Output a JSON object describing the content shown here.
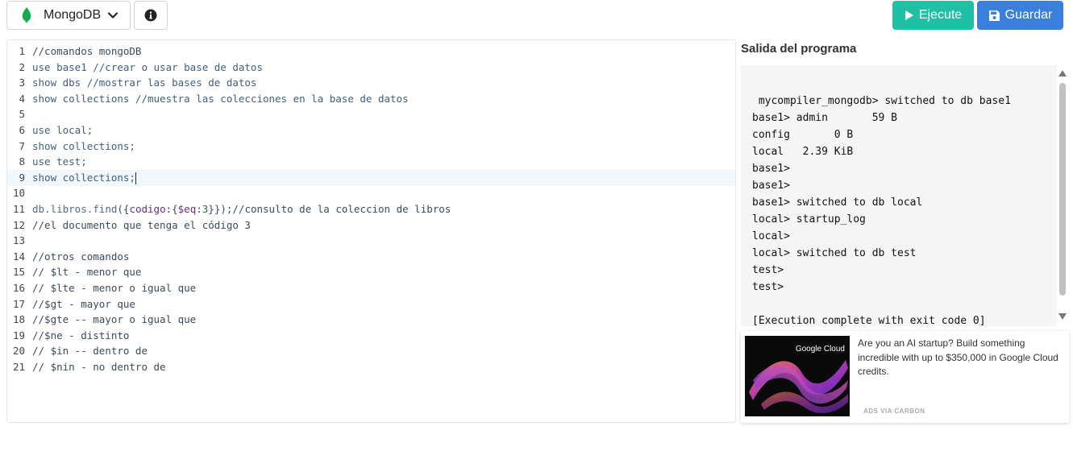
{
  "toolbar": {
    "language": "MongoDB",
    "run_label": "Ejecute",
    "save_label": "Guardar",
    "colors": {
      "run": "#20c0a4",
      "save": "#3a7fdc",
      "mongo_leaf": "#13aa52"
    }
  },
  "editor": {
    "active_line": 9,
    "lines": [
      {
        "n": "1",
        "tokens": [
          {
            "t": "//comandos mongoDB",
            "c": "cm"
          }
        ]
      },
      {
        "n": "2",
        "tokens": [
          {
            "t": "use base1 //crear o usar base de datos",
            "c": "kw"
          }
        ]
      },
      {
        "n": "3",
        "tokens": [
          {
            "t": "show dbs //mostrar las bases de datos",
            "c": "kw"
          }
        ]
      },
      {
        "n": "4",
        "tokens": [
          {
            "t": "show collections //muestra las colecciones en la base de datos",
            "c": "kw"
          }
        ]
      },
      {
        "n": "5",
        "tokens": []
      },
      {
        "n": "6",
        "tokens": [
          {
            "t": "use local;",
            "c": "kw"
          }
        ]
      },
      {
        "n": "7",
        "tokens": [
          {
            "t": "show collections;",
            "c": "kw"
          }
        ]
      },
      {
        "n": "8",
        "tokens": [
          {
            "t": "use test;",
            "c": "kw"
          }
        ]
      },
      {
        "n": "9",
        "tokens": [
          {
            "t": "show collections;",
            "c": "kw"
          }
        ]
      },
      {
        "n": "10",
        "tokens": []
      },
      {
        "n": "11",
        "tokens": [
          {
            "t": "db.",
            "c": "fn"
          },
          {
            "t": "libros",
            "c": "fn"
          },
          {
            "t": ".",
            "c": "fn"
          },
          {
            "t": "find",
            "c": "fn"
          },
          {
            "t": "({",
            "c": "cm"
          },
          {
            "t": "codigo",
            "c": "prop"
          },
          {
            "t": ":{",
            "c": "cm"
          },
          {
            "t": "$eq",
            "c": "prop"
          },
          {
            "t": ":",
            "c": "cm"
          },
          {
            "t": "3",
            "c": "num"
          },
          {
            "t": "}});//consulto de la coleccion de libros",
            "c": "cm"
          }
        ]
      },
      {
        "n": "12",
        "tokens": [
          {
            "t": "//el documento que tenga el código 3",
            "c": "cm"
          }
        ]
      },
      {
        "n": "13",
        "tokens": []
      },
      {
        "n": "14",
        "tokens": [
          {
            "t": "//otros comandos",
            "c": "cm"
          }
        ]
      },
      {
        "n": "15",
        "tokens": [
          {
            "t": "// $lt - menor que",
            "c": "cm"
          }
        ]
      },
      {
        "n": "16",
        "tokens": [
          {
            "t": "// $lte - menor o igual que",
            "c": "cm"
          }
        ]
      },
      {
        "n": "17",
        "tokens": [
          {
            "t": "//$gt - mayor que",
            "c": "cm"
          }
        ]
      },
      {
        "n": "18",
        "tokens": [
          {
            "t": "//$gte -- mayor o igual que",
            "c": "cm"
          }
        ]
      },
      {
        "n": "19",
        "tokens": [
          {
            "t": "//$ne - distinto",
            "c": "cm"
          }
        ]
      },
      {
        "n": "20",
        "tokens": [
          {
            "t": "// $in -- dentro de",
            "c": "cm"
          }
        ]
      },
      {
        "n": "21",
        "tokens": [
          {
            "t": "// $nin - no dentro de",
            "c": "cm"
          }
        ]
      }
    ]
  },
  "output": {
    "title": "Salida del programa",
    "lines": [
      "",
      " mycompiler_mongodb> switched to db base1",
      "base1> admin       59 B",
      "config       0 B",
      "local   2.39 KiB",
      "base1>",
      "base1>",
      "base1> switched to db local",
      "local> startup_log",
      "local>",
      "local> switched to db test",
      "test>",
      "test>",
      "",
      "[Execution complete with exit code 0]"
    ]
  },
  "ad": {
    "brand": "Google Cloud",
    "text": "Are you an AI startup? Build something incredible with up to $350,000 in Google Cloud credits.",
    "via": "ADS VIA CARBON"
  }
}
